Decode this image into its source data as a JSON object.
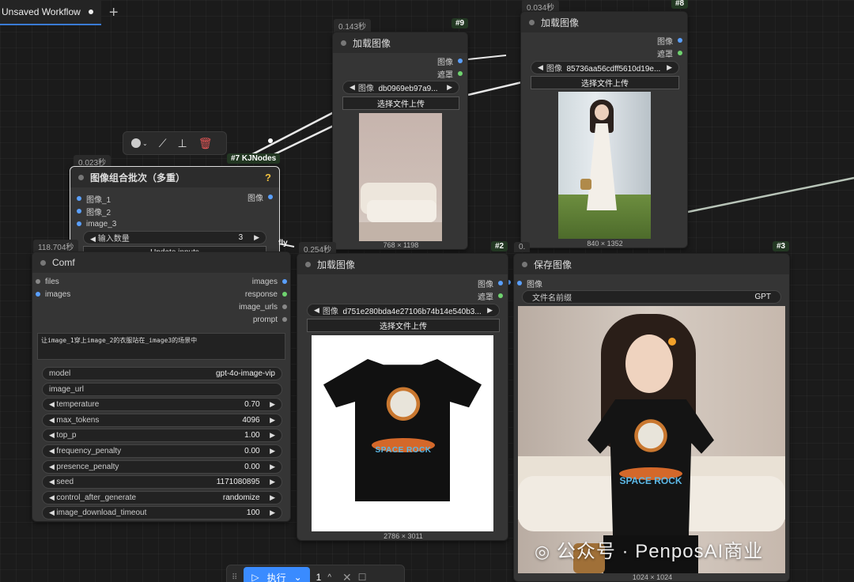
{
  "tab": {
    "title": "Unsaved Workflow",
    "add_label": "+"
  },
  "node_selected": {
    "timer": "0.023秒",
    "title": "图像组合批次（多重）",
    "badge": "#7 KJNodes",
    "help": "?",
    "inputs": [
      "图像_1",
      "图像_2",
      "image_3"
    ],
    "output": "图像",
    "count_label": "输入数量",
    "count_value": "3",
    "update_label": "Update inputs"
  },
  "node_gpt": {
    "timer": "118.704秒",
    "title": "Comf",
    "inputs": [
      "files",
      "images"
    ],
    "outputs": [
      "images",
      "response",
      "image_urls",
      "prompt"
    ],
    "prompt_text": "让image_1穿上image_2的衣服站在_image3的场景中",
    "widgets": [
      {
        "label": "model",
        "value": "gpt-4o-image-vip",
        "arrows": false
      },
      {
        "label": "image_url",
        "value": "",
        "arrows": false
      },
      {
        "label": "temperature",
        "value": "0.70",
        "arrows": true
      },
      {
        "label": "max_tokens",
        "value": "4096",
        "arrows": true
      },
      {
        "label": "top_p",
        "value": "1.00",
        "arrows": true
      },
      {
        "label": "frequency_penalty",
        "value": "0.00",
        "arrows": true
      },
      {
        "label": "presence_penalty",
        "value": "0.00",
        "arrows": true
      },
      {
        "label": "seed",
        "value": "1171080895",
        "arrows": true
      },
      {
        "label": "control_after_generate",
        "value": "randomize",
        "arrows": true
      },
      {
        "label": "image_download_timeout",
        "value": "100",
        "arrows": true
      }
    ]
  },
  "node_load9": {
    "timer": "0.143秒",
    "badge": "#9",
    "title": "加载图像",
    "out_image": "图像",
    "out_mask": "遮罩",
    "image_label": "图像",
    "image_value": "db0969eb97a9...",
    "upload_label": "选择文件上传",
    "dims": "768 × 1198"
  },
  "node_load8": {
    "timer": "0.034秒",
    "badge": "#8",
    "title": "加载图像",
    "out_image": "图像",
    "out_mask": "遮罩",
    "image_label": "图像",
    "image_value": "85736aa56cdff5610d19e...",
    "upload_label": "选择文件上传",
    "dims": "840 × 1352"
  },
  "node_load2": {
    "timer": "0.254秒",
    "badge": "#2",
    "title": "加载图像",
    "out_image": "图像",
    "out_mask": "遮罩",
    "image_label": "图像",
    "image_value": "d751e280bda4e27106b74b14e540b3...",
    "upload_label": "选择文件上传",
    "dims": "2786 × 3011"
  },
  "node_save3": {
    "timer": "0.",
    "badge": "#3",
    "title": "保存图像",
    "in_image": "图像",
    "prefix_label": "文件名前缀",
    "prefix_value": "GPT",
    "dims": "1024 × 1024"
  },
  "tshirt_text": "SPACE ROCK",
  "watermark": "公众号 · PenposAI商业",
  "runbar": {
    "run_label": "执行",
    "count": "1"
  },
  "fly_label": "fly",
  "colors": {
    "accent": "#3a8bff",
    "bg": "#1b1b1b",
    "node": "#353535"
  }
}
